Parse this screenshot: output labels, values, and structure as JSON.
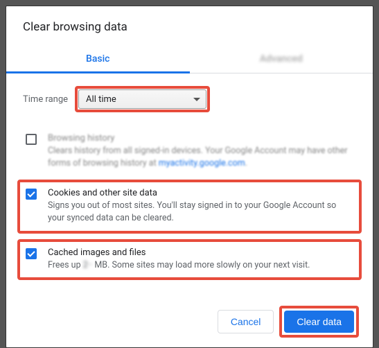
{
  "dialog": {
    "title": "Clear browsing data",
    "tabs": {
      "basic": "Basic",
      "advanced": "Advanced"
    },
    "time_range": {
      "label": "Time range",
      "value": "All time"
    },
    "options": {
      "history": {
        "title": "Browsing history",
        "desc_prefix": "Clears history from all signed-in devices. Your Google Account may have other forms of browsing history at ",
        "desc_link": "myactivity.google.com",
        "desc_suffix": ".",
        "checked": false
      },
      "cookies": {
        "title": "Cookies and other site data",
        "desc": "Signs you out of most sites. You'll stay signed in to your Google Account so your synced data can be cleared.",
        "checked": true
      },
      "cache": {
        "title": "Cached images and files",
        "desc_prefix": "Frees up ",
        "desc_blur": "2··",
        "desc_suffix": " MB. Some sites may load more slowly on your next visit.",
        "checked": true
      }
    },
    "buttons": {
      "cancel": "Cancel",
      "clear": "Clear data"
    }
  }
}
